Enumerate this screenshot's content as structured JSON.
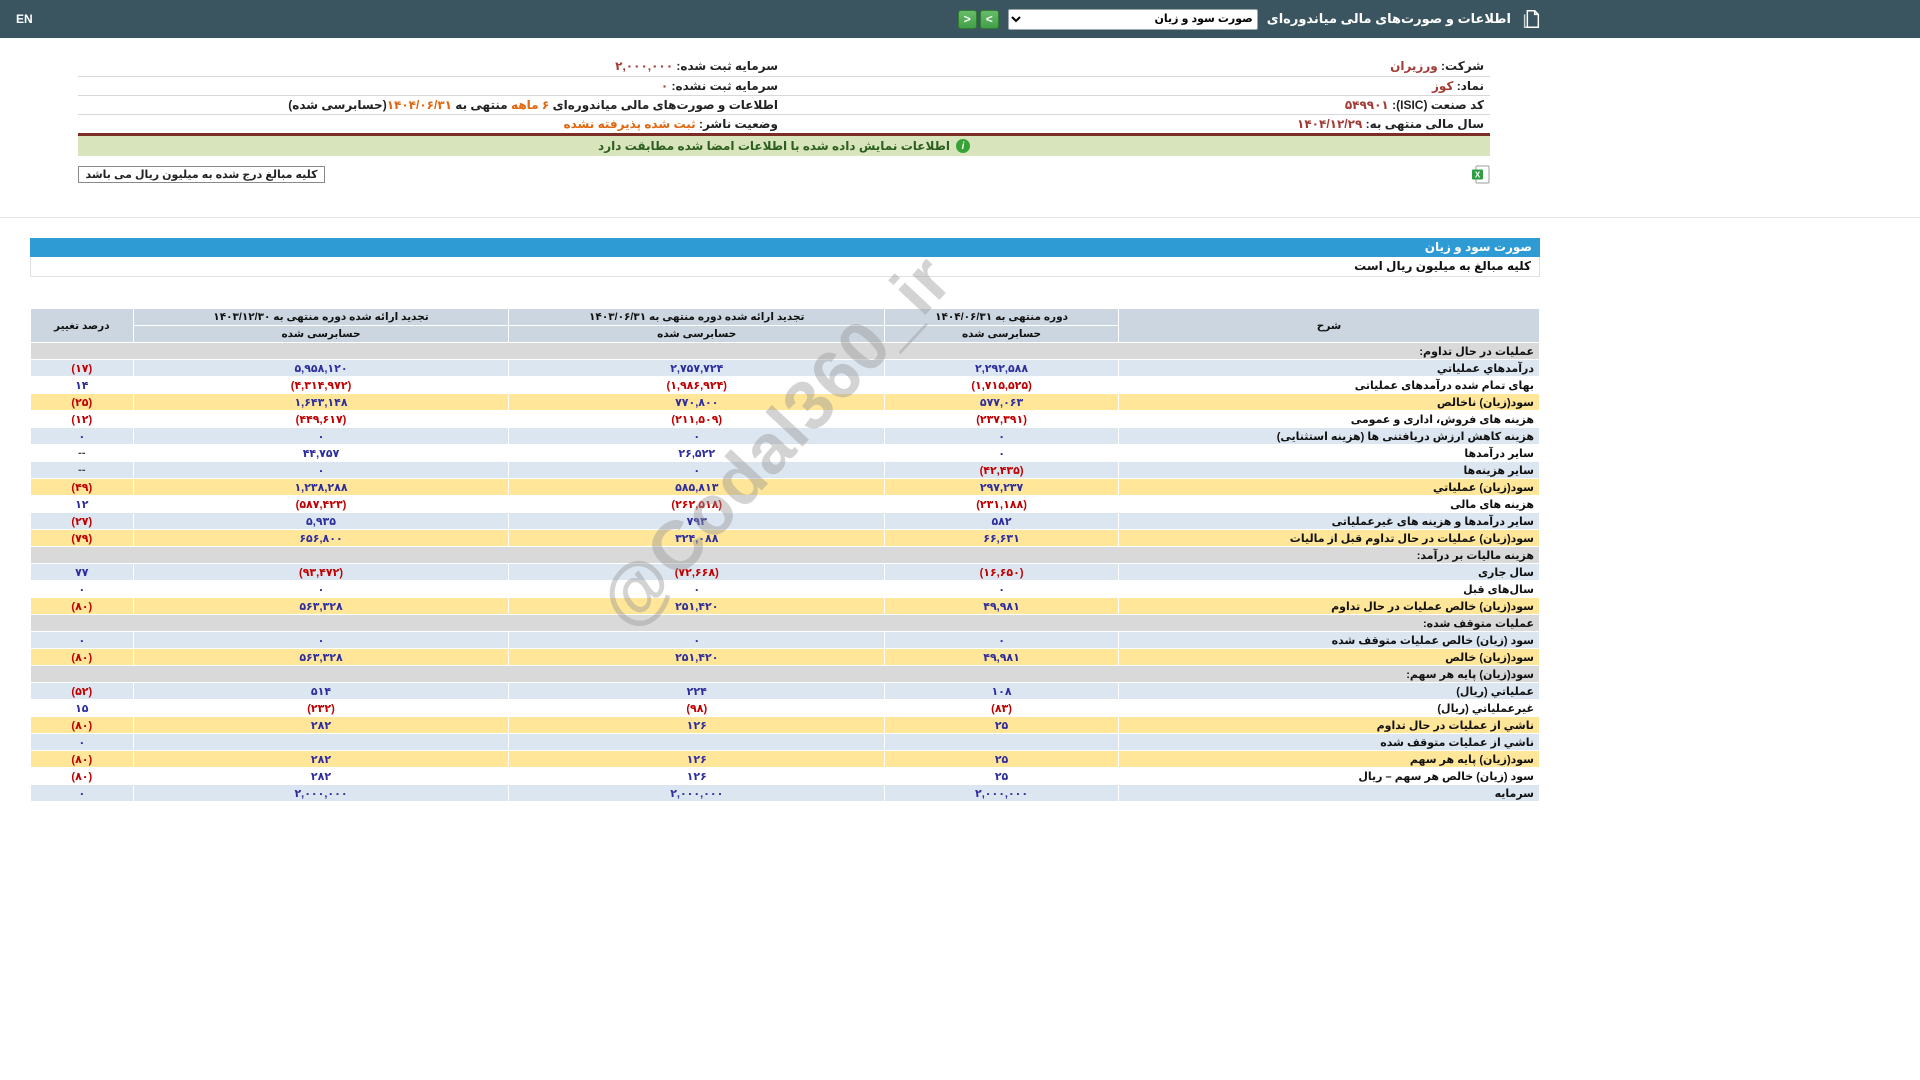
{
  "watermark": "@Codal360_ir",
  "topbar": {
    "title": "اطلاعات و صورت‌های مالی میاندوره‌ای",
    "dropdown_value": "صورت سود و زیان",
    "forward_label": ">",
    "back_label": "<",
    "en_label": "EN"
  },
  "info": {
    "company_label": "شرکت:",
    "company_value": "ورزیران",
    "symbol_label": "نماد:",
    "symbol_value": "کوز",
    "isic_label": "کد صنعت (ISIC):",
    "isic_value": "۵۴۹۹۰۱",
    "fiscal_year_label": "سال مالی منتهی به:",
    "fiscal_year_value": "۱۴۰۴/۱۲/۲۹",
    "registered_capital_label": "سرمایه ثبت شده:",
    "registered_capital_value": "۲,۰۰۰,۰۰۰",
    "unregistered_capital_label": "سرمایه ثبت نشده:",
    "unregistered_capital_value": "۰",
    "period_text_1": "اطلاعات و صورت‌های مالی میاندوره‌ای ",
    "period_text_2": "۶ ماهه",
    "period_text_3": " منتهی به ",
    "period_text_4": "۱۴۰۴/۰۶/۳۱",
    "period_text_5": "(حسابرسی شده)",
    "publisher_status_label": "وضعیت ناشر:",
    "publisher_status_value": "ثبت شده پذیرفته نشده",
    "signed_notice": "اطلاعات نمایش داده شده با اطلاعات امضا شده مطابقت دارد",
    "amounts_note": "کلیه مبالغ درج شده به میلیون ریال می باشد"
  },
  "table": {
    "title": "صورت سود و زیان",
    "subtitle": "کلیه مبالغ به میلیون ریال است",
    "col_desc": "شرح",
    "col_change": "درصد تغییر",
    "audited": "حسابرسی شده",
    "periods": [
      "دوره منتهی به ۱۴۰۴/۰۶/۳۱",
      "تجدید ارائه شده دوره منتهی به ۱۴۰۳/۰۶/۳۱",
      "تجدید ارائه شده دوره منتهی به ۱۴۰۳/۱۲/۳۰"
    ],
    "rows": [
      {
        "t": "s",
        "d": "عملیات در حال تداوم:"
      },
      {
        "t": "r",
        "bg": "blue",
        "d": "درآمدهاي عملياتي",
        "v": [
          "۲,۲۹۲,۵۸۸",
          "۲,۷۵۷,۷۲۴",
          "۵,۹۵۸,۱۲۰"
        ],
        "p": "(۱۷)"
      },
      {
        "t": "r",
        "bg": "white",
        "d": "بهای تمام شده درآمدهای عملیاتی",
        "v": [
          "(۱,۷۱۵,۵۲۵)",
          "(۱,۹۸۶,۹۲۴)",
          "(۴,۳۱۴,۹۷۲)"
        ],
        "p": "۱۴"
      },
      {
        "t": "r",
        "bg": "yellow",
        "d": "سود(زیان) ناخالص",
        "v": [
          "۵۷۷,۰۶۳",
          "۷۷۰,۸۰۰",
          "۱,۶۴۳,۱۴۸"
        ],
        "p": "(۲۵)"
      },
      {
        "t": "r",
        "bg": "white",
        "d": "هزینه های فروش، اداری و عمومی",
        "v": [
          "(۲۳۷,۳۹۱)",
          "(۲۱۱,۵۰۹)",
          "(۴۴۹,۶۱۷)"
        ],
        "p": "(۱۲)"
      },
      {
        "t": "r",
        "bg": "blue",
        "d": "هزینه کاهش ارزش دریافتنی ها (هزینه استثنایی)",
        "v": [
          "۰",
          "۰",
          "۰"
        ],
        "p": "۰"
      },
      {
        "t": "r",
        "bg": "white",
        "d": "سایر درآمدها",
        "v": [
          "۰",
          "۲۶,۵۲۲",
          "۴۴,۷۵۷"
        ],
        "p": "--"
      },
      {
        "t": "r",
        "bg": "blue",
        "d": "سایر هزینه‌ها",
        "v": [
          "(۴۲,۴۳۵)",
          "۰",
          "۰"
        ],
        "p": "--"
      },
      {
        "t": "r",
        "bg": "yellow",
        "d": "سود(زیان) عملیاتي",
        "v": [
          "۲۹۷,۲۳۷",
          "۵۸۵,۸۱۳",
          "۱,۲۳۸,۲۸۸"
        ],
        "p": "(۴۹)"
      },
      {
        "t": "r",
        "bg": "white",
        "d": "هزینه های مالی",
        "v": [
          "(۲۳۱,۱۸۸)",
          "(۲۶۲,۵۱۸)",
          "(۵۸۷,۴۲۳)"
        ],
        "p": "۱۲"
      },
      {
        "t": "r",
        "bg": "blue",
        "d": "سایر درآمدها و هزینه های غیرعملیاتی",
        "v": [
          "۵۸۲",
          "۷۹۳",
          "۵,۹۳۵"
        ],
        "p": "(۲۷)"
      },
      {
        "t": "r",
        "bg": "yellow",
        "d": "سود(زیان) عملیات در حال تداوم قبل از مالیات",
        "v": [
          "۶۶,۶۳۱",
          "۳۲۴,۰۸۸",
          "۶۵۶,۸۰۰"
        ],
        "p": "(۷۹)"
      },
      {
        "t": "s",
        "d": "هزینه مالیات بر درآمد:"
      },
      {
        "t": "r",
        "bg": "blue",
        "d": "سال جاری",
        "v": [
          "(۱۶,۶۵۰)",
          "(۷۲,۶۶۸)",
          "(۹۳,۴۷۲)"
        ],
        "p": "۷۷"
      },
      {
        "t": "r",
        "bg": "white",
        "d": "سال‌های قبل",
        "v": [
          "۰",
          "۰",
          "۰"
        ],
        "p": "۰"
      },
      {
        "t": "r",
        "bg": "yellow",
        "d": "سود(زیان) خالص عملیات در حال تداوم",
        "v": [
          "۴۹,۹۸۱",
          "۲۵۱,۴۲۰",
          "۵۶۳,۳۲۸"
        ],
        "p": "(۸۰)"
      },
      {
        "t": "s",
        "d": "عملیات متوقف شده:"
      },
      {
        "t": "r",
        "bg": "blue",
        "d": "سود (زیان) خالص عملیات متوقف شده",
        "v": [
          "۰",
          "۰",
          "۰"
        ],
        "p": "۰"
      },
      {
        "t": "r",
        "bg": "yellow",
        "d": "سود(زیان) خالص",
        "v": [
          "۴۹,۹۸۱",
          "۲۵۱,۴۲۰",
          "۵۶۳,۳۲۸"
        ],
        "p": "(۸۰)"
      },
      {
        "t": "s",
        "d": "سود(زیان) پایه هر سهم:"
      },
      {
        "t": "r",
        "bg": "blue",
        "d": "عملیاتي (ریال)",
        "v": [
          "۱۰۸",
          "۲۲۴",
          "۵۱۴"
        ],
        "p": "(۵۲)"
      },
      {
        "t": "r",
        "bg": "white",
        "d": "غیرعملیاتي (ریال)",
        "v": [
          "(۸۳)",
          "(۹۸)",
          "(۲۳۲)"
        ],
        "p": "۱۵"
      },
      {
        "t": "r",
        "bg": "yellow",
        "d": "ناشي از عملیات در حال تداوم",
        "v": [
          "۲۵",
          "۱۲۶",
          "۲۸۲"
        ],
        "p": "(۸۰)"
      },
      {
        "t": "r",
        "bg": "blue",
        "d": "ناشي از عملیات متوقف شده",
        "v": [
          "",
          "",
          ""
        ],
        "p": "۰"
      },
      {
        "t": "r",
        "bg": "yellow",
        "d": "سود(زیان) پایه هر سهم",
        "v": [
          "۲۵",
          "۱۲۶",
          "۲۸۲"
        ],
        "p": "(۸۰)"
      },
      {
        "t": "r",
        "bg": "white",
        "d": "سود (زیان) خالص هر سهم – ریال",
        "v": [
          "۲۵",
          "۱۲۶",
          "۲۸۲"
        ],
        "p": "(۸۰)"
      },
      {
        "t": "r",
        "bg": "blue",
        "d": "سرمایه",
        "v": [
          "۲,۰۰۰,۰۰۰",
          "۲,۰۰۰,۰۰۰",
          "۲,۰۰۰,۰۰۰"
        ],
        "p": "۰"
      }
    ]
  },
  "colors": {
    "topbar_bg": "#3a5560",
    "accent_blue": "#2e9bd5",
    "row_blue": "#dce6f1",
    "row_yellow": "#ffe699",
    "section_gray": "#d9d9d9",
    "negative_red": "#c00000",
    "positive_navy": "#2d2d9e",
    "notice_green_bg": "#d7e4bc",
    "maroon_value": "#a33a36",
    "orange_value": "#e0660f",
    "nav_button_green": "#43a047"
  }
}
